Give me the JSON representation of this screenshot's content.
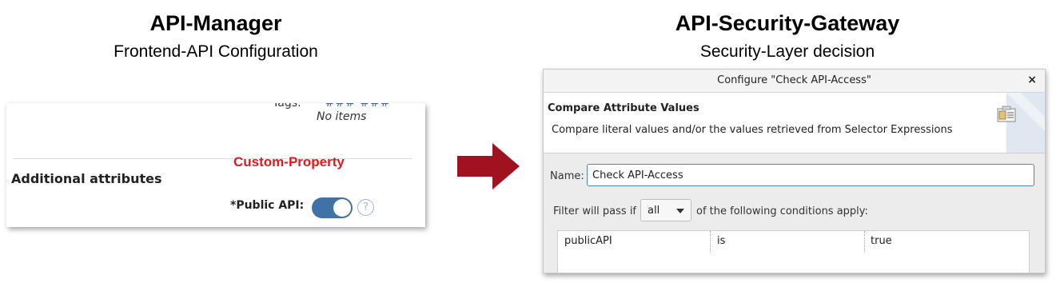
{
  "left": {
    "title": "API-Manager",
    "subtitle": "Frontend-API Configuration",
    "panel": {
      "tags_label": "Tags:",
      "tags_link": "###  ###",
      "no_items": "No items",
      "custom_property_label": "Custom-Property",
      "section_title": "Additional attributes",
      "public_api_label": "*Public API:",
      "public_api_toggle_on": true,
      "help_glyph": "?"
    }
  },
  "right": {
    "title": "API-Security-Gateway",
    "subtitle": "Security-Layer decision",
    "dialog": {
      "window_title": "Configure \"Check API-Access\"",
      "close_glyph": "×",
      "header_title": "Compare Attribute Values",
      "header_description": "Compare literal values and/or the values retrieved from Selector Expressions",
      "name_label": "Name:",
      "name_value": "Check API-Access",
      "filter_prefix": "Filter will pass if",
      "filter_mode": "all",
      "filter_suffix": "of the following conditions apply:",
      "conditions": [
        {
          "attribute": "publicAPI",
          "operator": "is",
          "value": "true"
        }
      ]
    }
  },
  "colors": {
    "arrow": "#a0121f",
    "custom_property_text": "#e01b1b",
    "toggle_on": "#3f73a8",
    "input_focus": "#4a86c6"
  },
  "icons": [
    "arrow-right-icon",
    "help-circle-icon",
    "close-icon",
    "dropdown-chevron-icon",
    "attribute-compare-icon"
  ]
}
